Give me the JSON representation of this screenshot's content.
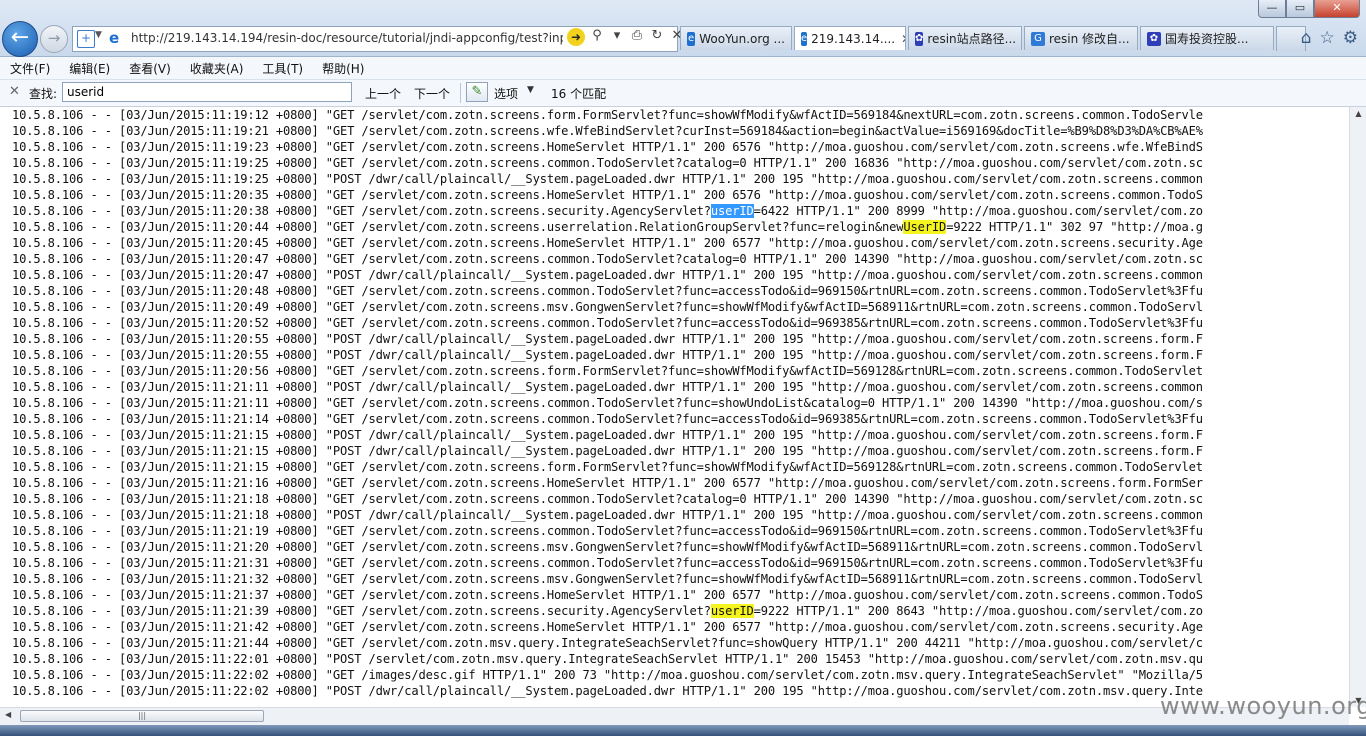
{
  "window": {
    "title": "",
    "controls": [
      "—",
      "▭",
      "✕"
    ]
  },
  "nav": {
    "back_glyph": "←",
    "forward_glyph": "→",
    "url": "http://219.143.14.194/resin-doc/resource/tutorial/jndi-appconfig/test?inpu",
    "tools": [
      "➜",
      "⚲",
      "▾",
      "⎙",
      "↻",
      "✕"
    ]
  },
  "tabs": [
    {
      "label": "WooYun.org ...",
      "icon": "wooyun-icon",
      "color": "#1e6fd0",
      "active": false,
      "closable": false
    },
    {
      "label": "219.143.14....",
      "icon": "ie-page-icon",
      "color": "#1e6fd0",
      "active": true,
      "closable": true
    },
    {
      "label": "resin站点路径...",
      "icon": "baidu-paw-icon",
      "color": "#2d3eb8",
      "active": false,
      "closable": false
    },
    {
      "label": "resin 修改自...",
      "icon": "google-icon",
      "color": "#2f7ad6",
      "active": false,
      "closable": false
    },
    {
      "label": "国寿投资控股...",
      "icon": "baidu-paw-icon",
      "color": "#2d3eb8",
      "active": false,
      "closable": false
    }
  ],
  "nav_right": [
    "⌂",
    "☆",
    "⚙"
  ],
  "menu": [
    "文件(F)",
    "编辑(E)",
    "查看(V)",
    "收藏夹(A)",
    "工具(T)",
    "帮助(H)"
  ],
  "find": {
    "close": "✕",
    "label": "查找:",
    "value": "userid",
    "prev": "上一个",
    "next": "下一个",
    "options": "选项",
    "count": "16 个匹配"
  },
  "log_lines": [
    [
      {
        "t": "10.5.8.106 - - [03/Jun/2015:11:19:12 +0800] \"GET /servlet/com.zotn.screens.form.FormServlet?func=showWfModify&wfActID=569184&nextURL=com.zotn.screens.common.TodoServle"
      }
    ],
    [
      {
        "t": "10.5.8.106 - - [03/Jun/2015:11:19:21 +0800] \"GET /servlet/com.zotn.screens.wfe.WfeBindServlet?curInst=569184&action=begin&actValue=i569169&docTitle=%B9%D8%D3%DA%CB%AE%"
      }
    ],
    [
      {
        "t": "10.5.8.106 - - [03/Jun/2015:11:19:23 +0800] \"GET /servlet/com.zotn.screens.HomeServlet HTTP/1.1\" 200 6576 \"http://moa.guoshou.com/servlet/com.zotn.screens.wfe.WfeBindS"
      }
    ],
    [
      {
        "t": "10.5.8.106 - - [03/Jun/2015:11:19:25 +0800] \"GET /servlet/com.zotn.screens.common.TodoServlet?catalog=0 HTTP/1.1\" 200 16836 \"http://moa.guoshou.com/servlet/com.zotn.sc"
      }
    ],
    [
      {
        "t": "10.5.8.106 - - [03/Jun/2015:11:19:25 +0800] \"POST /dwr/call/plaincall/__System.pageLoaded.dwr HTTP/1.1\" 200 195 \"http://moa.guoshou.com/servlet/com.zotn.screens.common"
      }
    ],
    [
      {
        "t": "10.5.8.106 - - [03/Jun/2015:11:20:35 +0800] \"GET /servlet/com.zotn.screens.HomeServlet HTTP/1.1\" 200 6576 \"http://moa.guoshou.com/servlet/com.zotn.screens.common.TodoS"
      }
    ],
    [
      {
        "t": "10.5.8.106 - - [03/Jun/2015:11:20:38 +0800] \"GET /servlet/com.zotn.screens.security.AgencyServlet?"
      },
      {
        "t": "userID",
        "h": "b"
      },
      {
        "t": "=6422 HTTP/1.1\" 200 8999 \"http://moa.guoshou.com/servlet/com.zo"
      }
    ],
    [
      {
        "t": "10.5.8.106 - - [03/Jun/2015:11:20:44 +0800] \"GET /servlet/com.zotn.screens.userrelation.RelationGroupServlet?func=relogin&new"
      },
      {
        "t": "UserID",
        "h": "y"
      },
      {
        "t": "=9222 HTTP/1.1\" 302 97 \"http://moa.g"
      }
    ],
    [
      {
        "t": "10.5.8.106 - - [03/Jun/2015:11:20:45 +0800] \"GET /servlet/com.zotn.screens.HomeServlet HTTP/1.1\" 200 6577 \"http://moa.guoshou.com/servlet/com.zotn.screens.security.Age"
      }
    ],
    [
      {
        "t": "10.5.8.106 - - [03/Jun/2015:11:20:47 +0800] \"GET /servlet/com.zotn.screens.common.TodoServlet?catalog=0 HTTP/1.1\" 200 14390 \"http://moa.guoshou.com/servlet/com.zotn.sc"
      }
    ],
    [
      {
        "t": "10.5.8.106 - - [03/Jun/2015:11:20:47 +0800] \"POST /dwr/call/plaincall/__System.pageLoaded.dwr HTTP/1.1\" 200 195 \"http://moa.guoshou.com/servlet/com.zotn.screens.common"
      }
    ],
    [
      {
        "t": "10.5.8.106 - - [03/Jun/2015:11:20:48 +0800] \"GET /servlet/com.zotn.screens.common.TodoServlet?func=accessTodo&id=969150&rtnURL=com.zotn.screens.common.TodoServlet%3Ffu"
      }
    ],
    [
      {
        "t": "10.5.8.106 - - [03/Jun/2015:11:20:49 +0800] \"GET /servlet/com.zotn.screens.msv.GongwenServlet?func=showWfModify&wfActID=568911&rtnURL=com.zotn.screens.common.TodoServl"
      }
    ],
    [
      {
        "t": "10.5.8.106 - - [03/Jun/2015:11:20:52 +0800] \"GET /servlet/com.zotn.screens.common.TodoServlet?func=accessTodo&id=969385&rtnURL=com.zotn.screens.common.TodoServlet%3Ffu"
      }
    ],
    [
      {
        "t": "10.5.8.106 - - [03/Jun/2015:11:20:55 +0800] \"POST /dwr/call/plaincall/__System.pageLoaded.dwr HTTP/1.1\" 200 195 \"http://moa.guoshou.com/servlet/com.zotn.screens.form.F"
      }
    ],
    [
      {
        "t": "10.5.8.106 - - [03/Jun/2015:11:20:55 +0800] \"POST /dwr/call/plaincall/__System.pageLoaded.dwr HTTP/1.1\" 200 195 \"http://moa.guoshou.com/servlet/com.zotn.screens.form.F"
      }
    ],
    [
      {
        "t": "10.5.8.106 - - [03/Jun/2015:11:20:56 +0800] \"GET /servlet/com.zotn.screens.form.FormServlet?func=showWfModify&wfActID=569128&rtnURL=com.zotn.screens.common.TodoServlet"
      }
    ],
    [
      {
        "t": "10.5.8.106 - - [03/Jun/2015:11:21:11 +0800] \"POST /dwr/call/plaincall/__System.pageLoaded.dwr HTTP/1.1\" 200 195 \"http://moa.guoshou.com/servlet/com.zotn.screens.common"
      }
    ],
    [
      {
        "t": "10.5.8.106 - - [03/Jun/2015:11:21:11 +0800] \"GET /servlet/com.zotn.screens.common.TodoServlet?func=showUndoList&catalog=0 HTTP/1.1\" 200 14390 \"http://moa.guoshou.com/s"
      }
    ],
    [
      {
        "t": "10.5.8.106 - - [03/Jun/2015:11:21:14 +0800] \"GET /servlet/com.zotn.screens.common.TodoServlet?func=accessTodo&id=969385&rtnURL=com.zotn.screens.common.TodoServlet%3Ffu"
      }
    ],
    [
      {
        "t": "10.5.8.106 - - [03/Jun/2015:11:21:15 +0800] \"POST /dwr/call/plaincall/__System.pageLoaded.dwr HTTP/1.1\" 200 195 \"http://moa.guoshou.com/servlet/com.zotn.screens.form.F"
      }
    ],
    [
      {
        "t": "10.5.8.106 - - [03/Jun/2015:11:21:15 +0800] \"POST /dwr/call/plaincall/__System.pageLoaded.dwr HTTP/1.1\" 200 195 \"http://moa.guoshou.com/servlet/com.zotn.screens.form.F"
      }
    ],
    [
      {
        "t": "10.5.8.106 - - [03/Jun/2015:11:21:15 +0800] \"GET /servlet/com.zotn.screens.form.FormServlet?func=showWfModify&wfActID=569128&rtnURL=com.zotn.screens.common.TodoServlet"
      }
    ],
    [
      {
        "t": "10.5.8.106 - - [03/Jun/2015:11:21:16 +0800] \"GET /servlet/com.zotn.screens.HomeServlet HTTP/1.1\" 200 6577 \"http://moa.guoshou.com/servlet/com.zotn.screens.form.FormSer"
      }
    ],
    [
      {
        "t": "10.5.8.106 - - [03/Jun/2015:11:21:18 +0800] \"GET /servlet/com.zotn.screens.common.TodoServlet?catalog=0 HTTP/1.1\" 200 14390 \"http://moa.guoshou.com/servlet/com.zotn.sc"
      }
    ],
    [
      {
        "t": "10.5.8.106 - - [03/Jun/2015:11:21:18 +0800] \"POST /dwr/call/plaincall/__System.pageLoaded.dwr HTTP/1.1\" 200 195 \"http://moa.guoshou.com/servlet/com.zotn.screens.common"
      }
    ],
    [
      {
        "t": "10.5.8.106 - - [03/Jun/2015:11:21:19 +0800] \"GET /servlet/com.zotn.screens.common.TodoServlet?func=accessTodo&id=969150&rtnURL=com.zotn.screens.common.TodoServlet%3Ffu"
      }
    ],
    [
      {
        "t": "10.5.8.106 - - [03/Jun/2015:11:21:20 +0800] \"GET /servlet/com.zotn.screens.msv.GongwenServlet?func=showWfModify&wfActID=568911&rtnURL=com.zotn.screens.common.TodoServl"
      }
    ],
    [
      {
        "t": "10.5.8.106 - - [03/Jun/2015:11:21:31 +0800] \"GET /servlet/com.zotn.screens.common.TodoServlet?func=accessTodo&id=969150&rtnURL=com.zotn.screens.common.TodoServlet%3Ffu"
      }
    ],
    [
      {
        "t": "10.5.8.106 - - [03/Jun/2015:11:21:32 +0800] \"GET /servlet/com.zotn.screens.msv.GongwenServlet?func=showWfModify&wfActID=568911&rtnURL=com.zotn.screens.common.TodoServl"
      }
    ],
    [
      {
        "t": "10.5.8.106 - - [03/Jun/2015:11:21:37 +0800] \"GET /servlet/com.zotn.screens.HomeServlet HTTP/1.1\" 200 6577 \"http://moa.guoshou.com/servlet/com.zotn.screens.common.TodoS"
      }
    ],
    [
      {
        "t": "10.5.8.106 - - [03/Jun/2015:11:21:39 +0800] \"GET /servlet/com.zotn.screens.security.AgencyServlet?"
      },
      {
        "t": "userID",
        "h": "y"
      },
      {
        "t": "=9222 HTTP/1.1\" 200 8643 \"http://moa.guoshou.com/servlet/com.zo"
      }
    ],
    [
      {
        "t": "10.5.8.106 - - [03/Jun/2015:11:21:42 +0800] \"GET /servlet/com.zotn.screens.HomeServlet HTTP/1.1\" 200 6577 \"http://moa.guoshou.com/servlet/com.zotn.screens.security.Age"
      }
    ],
    [
      {
        "t": "10.5.8.106 - - [03/Jun/2015:11:21:44 +0800] \"GET /servlet/com.zotn.msv.query.IntegrateSeachServlet?func=showQuery HTTP/1.1\" 200 44211 \"http://moa.guoshou.com/servlet/c"
      }
    ],
    [
      {
        "t": "10.5.8.106 - - [03/Jun/2015:11:22:01 +0800] \"POST /servlet/com.zotn.msv.query.IntegrateSeachServlet HTTP/1.1\" 200 15453 \"http://moa.guoshou.com/servlet/com.zotn.msv.qu"
      }
    ],
    [
      {
        "t": "10.5.8.106 - - [03/Jun/2015:11:22:02 +0800] \"GET /images/desc.gif HTTP/1.1\" 200 73 \"http://moa.guoshou.com/servlet/com.zotn.msv.query.IntegrateSeachServlet\" \"Mozilla/5"
      }
    ],
    [
      {
        "t": "10.5.8.106 - - [03/Jun/2015:11:22:02 +0800] \"POST /dwr/call/plaincall/__System.pageLoaded.dwr HTTP/1.1\" 200 195 \"http://moa.guoshou.com/servlet/com.zotn.msv.query.Inte"
      }
    ]
  ],
  "scrollbar": {
    "up": "▲",
    "down": "▼",
    "left": "◀",
    "thumb_grip": "|||"
  },
  "watermark": "www.wooyun.org"
}
